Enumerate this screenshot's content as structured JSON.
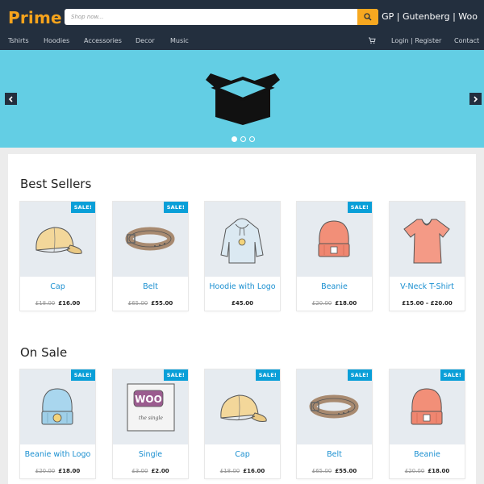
{
  "header": {
    "logo": "Prime",
    "search_placeholder": "Shop now...",
    "brand_right": "GP | Gutenberg | Woo"
  },
  "nav": {
    "items": [
      "Tshirts",
      "Hoodies",
      "Accessories",
      "Decor",
      "Music"
    ],
    "login": "Login | Register",
    "contact": "Contact"
  },
  "colors": {
    "header_bg": "#232f3e",
    "accent": "#f6a31c",
    "hero_bg": "#63cee4",
    "sale_badge": "#0a9fd8",
    "link": "#1a8fd0"
  },
  "hero": {
    "icon": "box-icon",
    "slides": 3,
    "active_slide": 1
  },
  "sections": [
    {
      "title": "Best Sellers",
      "products": [
        {
          "name": "Cap",
          "old_price": "£18.00",
          "price": "£16.00",
          "sale": "SALE!",
          "icon": "cap-icon"
        },
        {
          "name": "Belt",
          "old_price": "£65.00",
          "price": "£55.00",
          "sale": "SALE!",
          "icon": "belt-icon"
        },
        {
          "name": "Hoodie with Logo",
          "old_price": "",
          "price": "£45.00",
          "sale": "",
          "icon": "hoodie-icon"
        },
        {
          "name": "Beanie",
          "old_price": "£20.00",
          "price": "£18.00",
          "sale": "SALE!",
          "icon": "beanie-icon"
        },
        {
          "name": "V-Neck T-Shirt",
          "old_price": "",
          "price": "£15.00 – £20.00",
          "sale": "",
          "icon": "tshirt-icon"
        }
      ]
    },
    {
      "title": "On Sale",
      "products": [
        {
          "name": "Beanie with Logo",
          "old_price": "£20.00",
          "price": "£18.00",
          "sale": "SALE!",
          "icon": "beanie-logo-icon"
        },
        {
          "name": "Single",
          "old_price": "£3.00",
          "price": "£2.00",
          "sale": "SALE!",
          "icon": "single-icon"
        },
        {
          "name": "Cap",
          "old_price": "£18.00",
          "price": "£16.00",
          "sale": "SALE!",
          "icon": "cap-icon"
        },
        {
          "name": "Belt",
          "old_price": "£65.00",
          "price": "£55.00",
          "sale": "SALE!",
          "icon": "belt-icon"
        },
        {
          "name": "Beanie",
          "old_price": "£20.00",
          "price": "£18.00",
          "sale": "SALE!",
          "icon": "beanie-icon"
        }
      ]
    }
  ],
  "single_art": {
    "badge": "WOO",
    "caption": "the single"
  }
}
